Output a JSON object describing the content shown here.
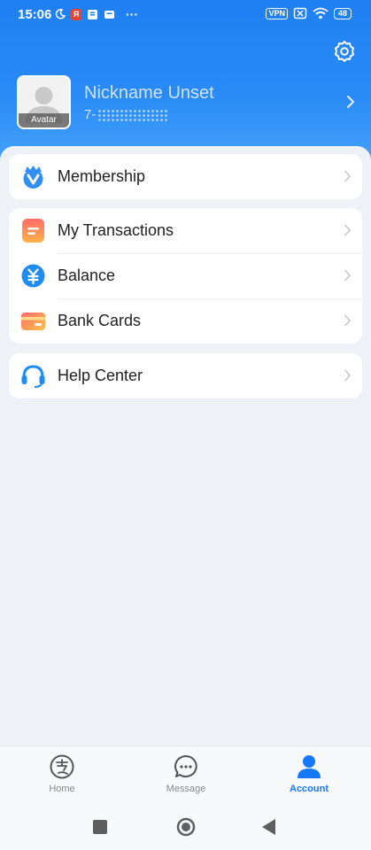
{
  "status_bar": {
    "time": "15:06",
    "vpn": "VPN",
    "battery": "48",
    "more_indicator": "···",
    "app_badge": "Я"
  },
  "header": {
    "settings_icon": "gear-icon"
  },
  "profile": {
    "avatar_label": "Avatar",
    "nickname": "Nickname Unset",
    "user_id_prefix": "7-"
  },
  "menu_groups": [
    {
      "items": [
        {
          "label": "Membership",
          "icon": "membership-icon"
        }
      ]
    },
    {
      "items": [
        {
          "label": "My Transactions",
          "icon": "transactions-icon"
        },
        {
          "label": "Balance",
          "icon": "yen-coin-icon"
        },
        {
          "label": "Bank Cards",
          "icon": "bank-card-icon"
        }
      ]
    },
    {
      "items": [
        {
          "label": "Help Center",
          "icon": "headset-icon"
        }
      ]
    }
  ],
  "tab_bar": {
    "tabs": [
      {
        "label": "Home",
        "icon": "alipay-home-icon",
        "active": false
      },
      {
        "label": "Message",
        "icon": "chat-bubble-icon",
        "active": false
      },
      {
        "label": "Account",
        "icon": "person-icon",
        "active": true
      }
    ]
  },
  "colors": {
    "accent": "#1677ff",
    "header_top": "#1f7ff1",
    "header_bottom": "#4aa8fb",
    "page_background": "#eef1f5"
  }
}
